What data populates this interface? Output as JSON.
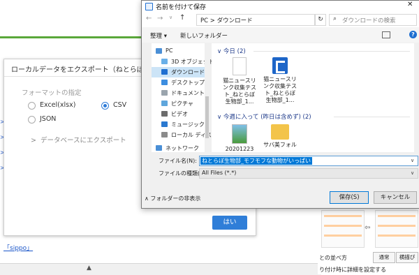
{
  "background": {
    "link_text": "「sippo」",
    "right_panel": {
      "label_left": "との並べ方",
      "btn_standard": "通常",
      "btn_horizontal": "横描ぴ",
      "bottom_text": "り付け時に詳細を設定する"
    }
  },
  "export_modal": {
    "title": "ローカルデータをエクスポート（ねとらぼ生物",
    "format_label": "フォーマットの指定",
    "options": [
      {
        "label": "Excel(xlsx)",
        "checked": false
      },
      {
        "label": "CSV",
        "checked": true
      },
      {
        "label": "JSON",
        "checked": false
      }
    ],
    "db_export": "データベースにエクスポート",
    "ok_button": "はい"
  },
  "save_dialog": {
    "title": "名前を付けて保存",
    "close": "✕",
    "address": "PC  >  ダウンロード",
    "search_placeholder": "ダウンロードの検索",
    "toolbar": {
      "organize": "整理 ▾",
      "new_folder": "新しいフォルダー"
    },
    "nav_items": [
      {
        "label": "PC",
        "icon": "pc-icon",
        "color": "#4a8fd6"
      },
      {
        "label": "3D オブジェクト",
        "icon": "3d-objects-icon",
        "color": "#6ab0e8"
      },
      {
        "label": "ダウンロード",
        "icon": "download-icon",
        "color": "#1f6fd1",
        "selected": true
      },
      {
        "label": "デスクトップ",
        "icon": "desktop-icon",
        "color": "#3d8ee0"
      },
      {
        "label": "ドキュメント",
        "icon": "documents-icon",
        "color": "#9aa4ad"
      },
      {
        "label": "ピクチャ",
        "icon": "pictures-icon",
        "color": "#5fa6dc"
      },
      {
        "label": "ビデオ",
        "icon": "videos-icon",
        "color": "#6c6c6c"
      },
      {
        "label": "ミュージック",
        "icon": "music-icon",
        "color": "#2b79d0"
      },
      {
        "label": "ローカル ディスク (C",
        "icon": "disk-icon",
        "color": "#8b8b8b"
      },
      {
        "label": "ネットワーク",
        "icon": "network-icon",
        "color": "#4a8fd6"
      }
    ],
    "groups": [
      {
        "header": "∨  今日 (2)",
        "files": [
          {
            "name": "猫ニュースリ\nンク収集テス\nト_ねとらぼ\n生物部_1...",
            "icon": "document-icon"
          },
          {
            "name": "猫ニュースリ\nンク収集テス\nト_ねとらぼ\n生物部_1...",
            "icon": "app-file-icon"
          }
        ]
      },
      {
        "header": "∨  今週に入って (昨日は含めず) (2)",
        "files": [
          {
            "name": "20201223",
            "icon": "image-file-icon"
          },
          {
            "name": "サバ美フォル",
            "icon": "folder-icon"
          }
        ]
      }
    ],
    "filename_label": "ファイル名(N):",
    "filename_value": "ねとらぼ生物部_モフモフな動物がいっぱい",
    "filetype_label": "ファイルの種類(T):",
    "filetype_value": "All Files (*.*)",
    "hide_folders": "フォルダーの非表示",
    "save_button": "保存(S)",
    "cancel_button": "キャンセル"
  }
}
